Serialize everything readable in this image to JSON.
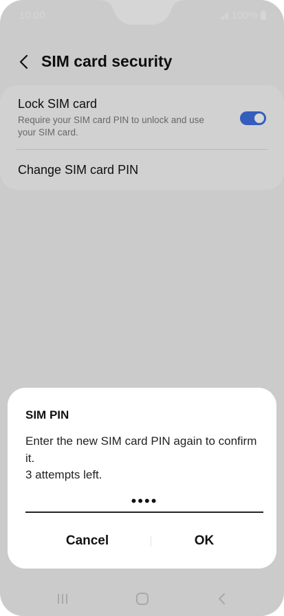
{
  "status_bar": {
    "time": "10:00",
    "battery": "100%"
  },
  "header": {
    "title": "SIM card security"
  },
  "settings": {
    "lock_sim_title": "Lock SIM card",
    "lock_sim_desc": "Require your SIM card PIN to unlock and use your SIM card.",
    "lock_sim_enabled": true,
    "change_pin_title": "Change SIM card PIN"
  },
  "dialog": {
    "title": "SIM PIN",
    "message_line1": "Enter the new SIM card PIN again to confirm it.",
    "message_line2": "3 attempts left.",
    "pin_value": "••••",
    "cancel_label": "Cancel",
    "ok_label": "OK"
  },
  "colors": {
    "accent": "#3e6fe0",
    "dim_overlay": "rgba(0,0,0,0.16)"
  },
  "icons": [
    "back-arrow-icon",
    "signal-icon",
    "battery-icon",
    "recent-apps-icon",
    "home-icon",
    "back-icon"
  ]
}
